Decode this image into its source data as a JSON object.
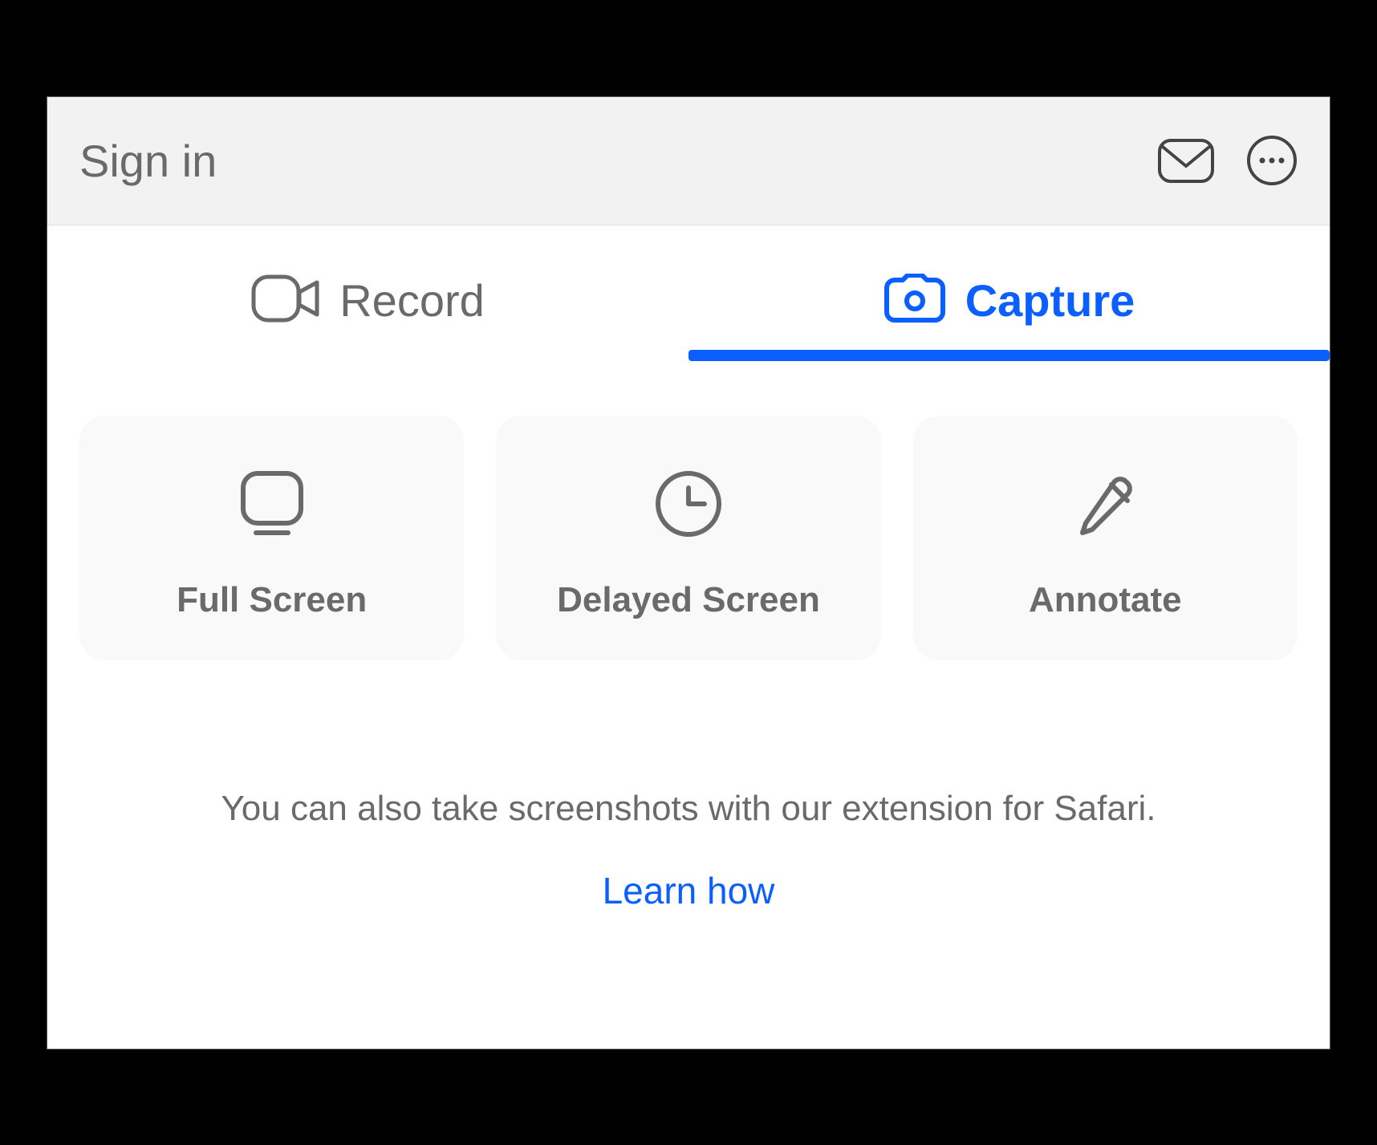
{
  "header": {
    "signin": "Sign in"
  },
  "tabs": {
    "record": "Record",
    "capture": "Capture"
  },
  "cards": {
    "full_screen": "Full Screen",
    "delayed_screen": "Delayed Screen",
    "annotate": "Annotate"
  },
  "footer": {
    "message": "You can also take screenshots with our extension for Safari.",
    "link": "Learn how"
  },
  "colors": {
    "accent": "#0b5fff",
    "muted": "#6a6a6a",
    "card_bg": "#f9f9f9",
    "titlebar_bg": "#f2f2f2"
  }
}
